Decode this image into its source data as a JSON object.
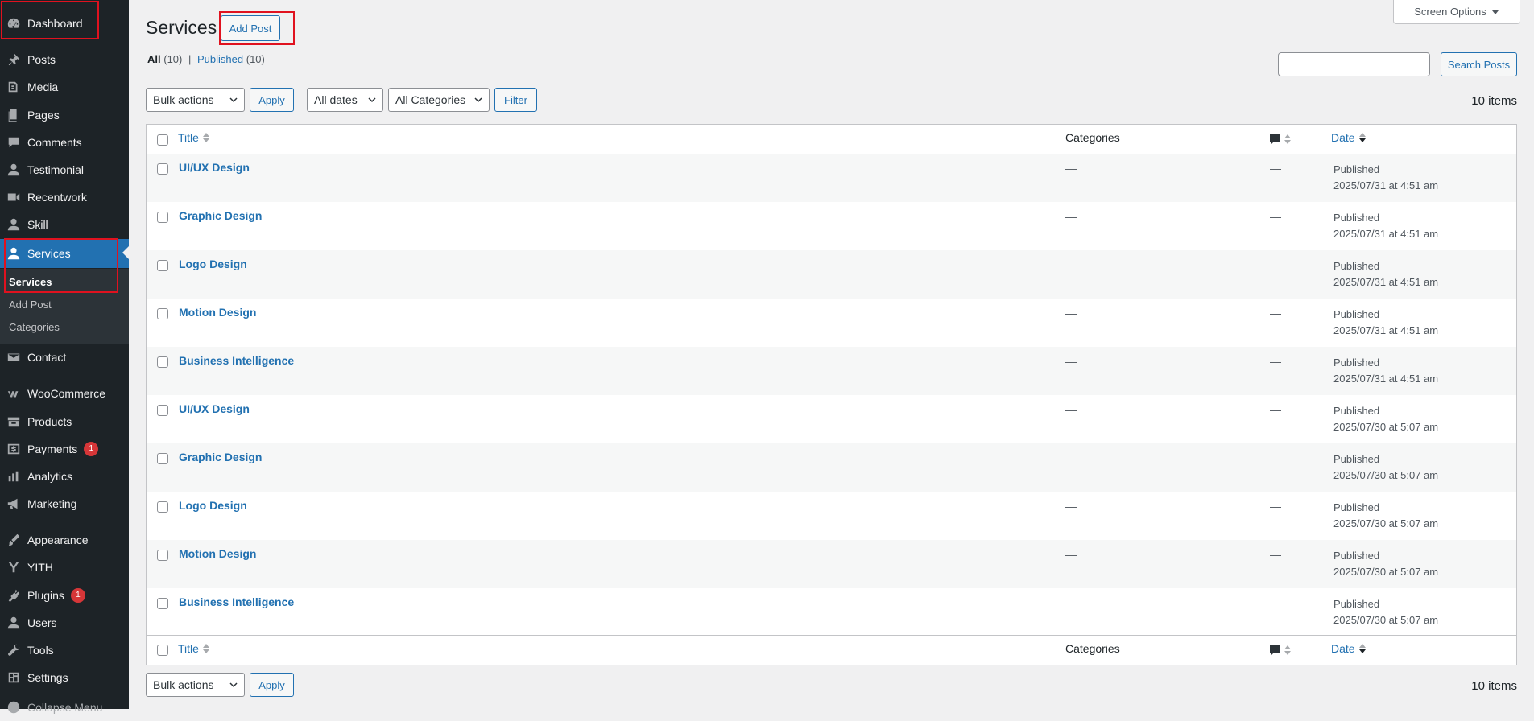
{
  "sidebar": {
    "items": [
      {
        "label": "Dashboard",
        "icon": "dashboard-icon"
      },
      {
        "label": "Posts",
        "icon": "pin-icon"
      },
      {
        "label": "Media",
        "icon": "media-icon"
      },
      {
        "label": "Pages",
        "icon": "pages-icon"
      },
      {
        "label": "Comments",
        "icon": "comment-icon"
      },
      {
        "label": "Testimonial",
        "icon": "user-icon"
      },
      {
        "label": "Recentwork",
        "icon": "video-icon"
      },
      {
        "label": "Skill",
        "icon": "user-icon"
      },
      {
        "label": "Services",
        "icon": "user-icon"
      },
      {
        "label": "Contact",
        "icon": "mail-icon"
      },
      {
        "label": "WooCommerce",
        "icon": "woo-icon"
      },
      {
        "label": "Products",
        "icon": "archive-icon"
      },
      {
        "label": "Payments",
        "icon": "dollar-icon",
        "badge": "1"
      },
      {
        "label": "Analytics",
        "icon": "chart-icon"
      },
      {
        "label": "Marketing",
        "icon": "megaphone-icon"
      },
      {
        "label": "Appearance",
        "icon": "brush-icon"
      },
      {
        "label": "YITH",
        "icon": "yith-icon"
      },
      {
        "label": "Plugins",
        "icon": "plugin-icon",
        "badge": "1"
      },
      {
        "label": "Users",
        "icon": "user-icon"
      },
      {
        "label": "Tools",
        "icon": "wrench-icon"
      },
      {
        "label": "Settings",
        "icon": "settings-icon"
      },
      {
        "label": "Collapse Menu",
        "icon": "collapse-icon"
      }
    ],
    "submenu": [
      {
        "label": "Services"
      },
      {
        "label": "Add Post"
      },
      {
        "label": "Categories"
      }
    ]
  },
  "header": {
    "title": "Services",
    "add_button": "Add Post",
    "screen_options": "Screen Options"
  },
  "views": {
    "all_label": "All",
    "all_count": "(10)",
    "separator": "|",
    "published_label": "Published",
    "published_count": "(10)"
  },
  "search": {
    "value": "",
    "button": "Search Posts"
  },
  "filters": {
    "bulk_actions": "Bulk actions",
    "apply": "Apply",
    "dates": "All dates",
    "categories": "All Categories",
    "filter": "Filter",
    "items_count": "10 items"
  },
  "table": {
    "columns": {
      "title": "Title",
      "categories": "Categories",
      "date": "Date"
    },
    "rows": [
      {
        "title": "UI/UX Design",
        "categories": "—",
        "comments": "—",
        "status": "Published",
        "date": "2025/07/31 at 4:51 am"
      },
      {
        "title": "Graphic Design",
        "categories": "—",
        "comments": "—",
        "status": "Published",
        "date": "2025/07/31 at 4:51 am"
      },
      {
        "title": "Logo Design",
        "categories": "—",
        "comments": "—",
        "status": "Published",
        "date": "2025/07/31 at 4:51 am"
      },
      {
        "title": "Motion Design",
        "categories": "—",
        "comments": "—",
        "status": "Published",
        "date": "2025/07/31 at 4:51 am"
      },
      {
        "title": "Business Intelligence",
        "categories": "—",
        "comments": "—",
        "status": "Published",
        "date": "2025/07/31 at 4:51 am"
      },
      {
        "title": "UI/UX Design",
        "categories": "—",
        "comments": "—",
        "status": "Published",
        "date": "2025/07/30 at 5:07 am"
      },
      {
        "title": "Graphic Design",
        "categories": "—",
        "comments": "—",
        "status": "Published",
        "date": "2025/07/30 at 5:07 am"
      },
      {
        "title": "Logo Design",
        "categories": "—",
        "comments": "—",
        "status": "Published",
        "date": "2025/07/30 at 5:07 am"
      },
      {
        "title": "Motion Design",
        "categories": "—",
        "comments": "—",
        "status": "Published",
        "date": "2025/07/30 at 5:07 am"
      },
      {
        "title": "Business Intelligence",
        "categories": "—",
        "comments": "—",
        "status": "Published",
        "date": "2025/07/30 at 5:07 am"
      }
    ]
  },
  "bottom": {
    "bulk_actions": "Bulk actions",
    "apply": "Apply",
    "items_count": "10 items"
  },
  "colors": {
    "sidebar_bg": "#1d2327",
    "accent": "#2271b1",
    "link": "#2271b1",
    "highlight_box": "#e0121f",
    "badge": "#d63638"
  }
}
